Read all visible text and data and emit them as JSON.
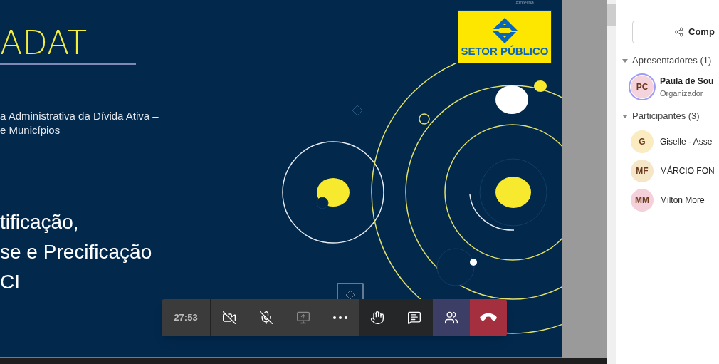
{
  "slide": {
    "tag": "#interna",
    "title": "ADAT",
    "subtitle_lines": [
      "a Administrativa da Dívida Ativa –",
      "e Municípios"
    ],
    "heading_lines": [
      "tificação,",
      "se e Precificação",
      "CI"
    ],
    "logo_text": "SETOR PÚBLICO"
  },
  "call_controls": {
    "timer": "27:53",
    "buttons": [
      {
        "kind": "camera",
        "on": false,
        "selected": false,
        "disabled": false
      },
      {
        "kind": "mic",
        "on": false,
        "selected": false,
        "disabled": false
      },
      {
        "kind": "share",
        "selected": false,
        "disabled": true
      },
      {
        "kind": "more",
        "selected": false,
        "disabled": false
      },
      {
        "kind": "hand",
        "selected": false,
        "disabled": false
      },
      {
        "kind": "chat",
        "selected": false,
        "disabled": false
      },
      {
        "kind": "people",
        "selected": true,
        "disabled": false
      },
      {
        "kind": "hangup",
        "disabled": false
      }
    ]
  },
  "people_panel": {
    "share_button": "Comp",
    "sections": [
      {
        "label": "Apresentadores (1)",
        "expanded": true,
        "people": [
          {
            "initials": "PC",
            "name": "Paula de Sou",
            "role": "Organizador",
            "color": "#f4d3dc",
            "highlighted": true
          }
        ]
      },
      {
        "label": "Participantes (3)",
        "expanded": true,
        "people": [
          {
            "initials": "G",
            "name": "Giselle - Asse",
            "color": "#fbebc0",
            "highlighted": false
          },
          {
            "initials": "MF",
            "name": "MÁRCIO FON",
            "color": "#f5e6c8",
            "highlighted": false
          },
          {
            "initials": "MM",
            "name": "Milton More",
            "color": "#f3d0da",
            "highlighted": false
          }
        ]
      }
    ]
  }
}
